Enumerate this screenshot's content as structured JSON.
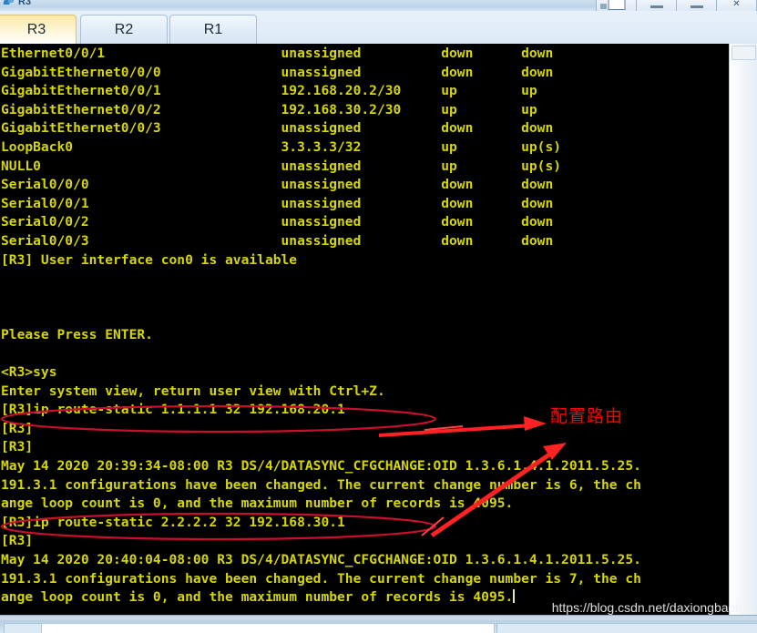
{
  "window": {
    "title": "R3",
    "buttons": [
      {
        "name": "restore-window-button",
        "glyph": "restore"
      },
      {
        "name": "minimize-window-button",
        "glyph": "minimize"
      },
      {
        "name": "maximize-window-button",
        "glyph": "maximize"
      },
      {
        "name": "close-window-button",
        "glyph": "close"
      }
    ]
  },
  "tabs": [
    {
      "label": "R3",
      "active": true
    },
    {
      "label": "R2",
      "active": false
    },
    {
      "label": "R1",
      "active": false
    }
  ],
  "terminal": {
    "foreground": "#d7d700",
    "background": "#000000",
    "lines": [
      "Ethernet0/0/1                      unassigned          down      down",
      "GigabitEthernet0/0/0               unassigned          down      down",
      "GigabitEthernet0/0/1               192.168.20.2/30     up        up",
      "GigabitEthernet0/0/2               192.168.30.2/30     up        up",
      "GigabitEthernet0/0/3               unassigned          down      down",
      "LoopBack0                          3.3.3.3/32          up        up(s)",
      "NULL0                              unassigned          up        up(s)",
      "Serial0/0/0                        unassigned          down      down",
      "Serial0/0/1                        unassigned          down      down",
      "Serial0/0/2                        unassigned          down      down",
      "Serial0/0/3                        unassigned          down      down",
      "[R3] User interface con0 is available",
      "",
      "",
      "",
      "Please Press ENTER.",
      "",
      "<R3>sys",
      "Enter system view, return user view with Ctrl+Z.",
      "[R3]ip route-static 1.1.1.1 32 192.168.20.1",
      "[R3]",
      "[R3]",
      "May 14 2020 20:39:34-08:00 R3 DS/4/DATASYNC_CFGCHANGE:OID 1.3.6.1.4.1.2011.5.25.",
      "191.3.1 configurations have been changed. The current change number is 6, the ch",
      "ange loop count is 0, and the maximum number of records is 4095.",
      "[R3]ip route-static 2.2.2.2 32 192.168.30.1",
      "[R3]",
      "May 14 2020 20:40:04-08:00 R3 DS/4/DATASYNC_CFGCHANGE:OID 1.3.6.1.4.1.2011.5.25.",
      "191.3.1 configurations have been changed. The current change number is 7, the ch",
      "ange loop count is 0, and the maximum number of records is 4095."
    ]
  },
  "annotations": {
    "color": "#ff0000",
    "label": "配置路由",
    "ellipse_targets": [
      "[R3]ip route-static 1.1.1.1 32 192.168.20.1",
      "[R3]ip route-static 2.2.2.2 32 192.168.30.1"
    ]
  },
  "watermark": "https://blog.csdn.net/daxiongbaobei"
}
